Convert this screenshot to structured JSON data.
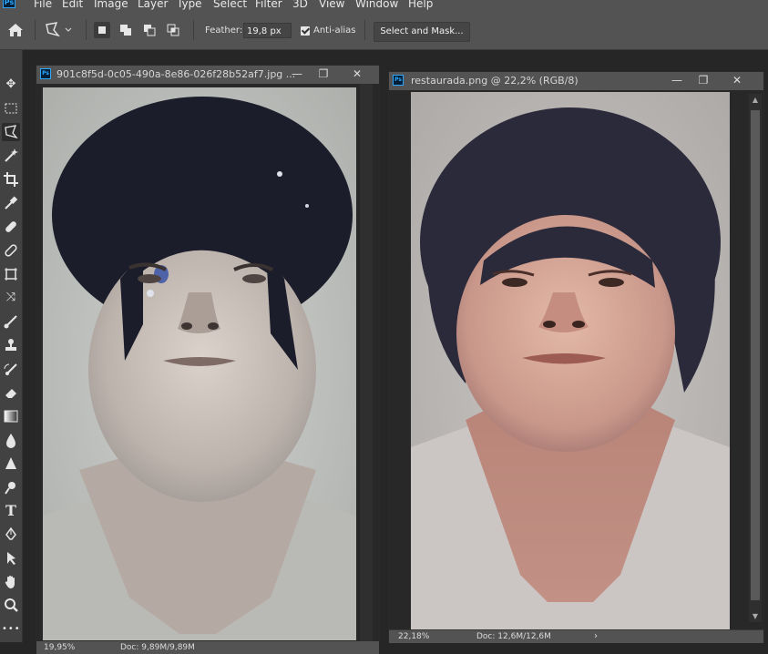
{
  "menu": [
    "File",
    "Edit",
    "Image",
    "Layer",
    "Type",
    "Select",
    "Filter",
    "3D",
    "View",
    "Window",
    "Help"
  ],
  "logo": "Ps",
  "options": {
    "feather_label": "Feather:",
    "feather_value": "19,8 px",
    "antialias_label": "Anti-alias",
    "antialias_checked": true,
    "select_mask_label": "Select and Mask..."
  },
  "tools": [
    "move-tool",
    "marquee-tool",
    "lasso-tool",
    "magic-wand-tool",
    "crop-tool",
    "eyedropper-tool",
    "healing-brush-tool",
    "patch-tool",
    "frame-tool",
    "content-aware-move-tool",
    "brush-tool",
    "clone-stamp-tool",
    "history-brush-tool",
    "eraser-tool",
    "gradient-tool",
    "blur-tool",
    "sharpen-tool",
    "dodge-tool",
    "type-tool",
    "pen-tool",
    "path-selection-tool",
    "hand-tool",
    "zoom-tool",
    "more-tools"
  ],
  "left_doc": {
    "title": "901c8f5d-0c05-490a-8e86-026f28b52af7.jpg ...",
    "status_zoom": "19,95%",
    "status_doc": "Doc: 9,89M/9,89M"
  },
  "right_doc": {
    "title": "restaurada.png @ 22,2% (RGB/8)",
    "status_zoom": "22,18%",
    "status_doc": "Doc: 12,6M/12,6M"
  },
  "colors": {
    "ui_bg": "#535353",
    "panel_bg": "#424242",
    "canvas_bg": "#282828",
    "ps_blue": "#31a8ff"
  }
}
